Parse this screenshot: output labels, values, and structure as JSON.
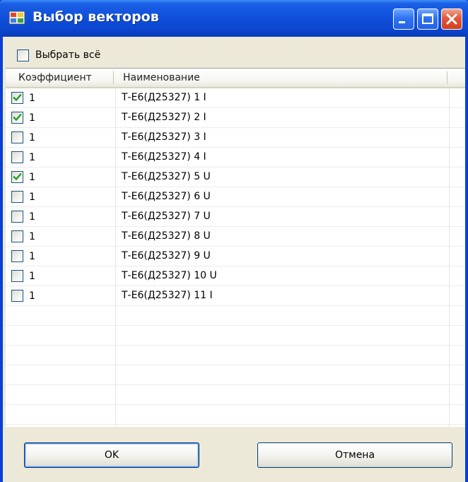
{
  "window": {
    "title": "Выбор векторов",
    "icon": "app-window-icon",
    "controls": [
      "minimize-icon",
      "maximize-icon",
      "close-icon"
    ]
  },
  "select_all": {
    "label": "Выбрать всё",
    "checked": false
  },
  "grid": {
    "columns": [
      "Коэффициент",
      "Наименование"
    ],
    "rows": [
      {
        "coef": "1",
        "name": "Т-Е6(Д25327) 1 I",
        "checked": true
      },
      {
        "coef": "1",
        "name": "Т-Е6(Д25327) 2 I",
        "checked": true
      },
      {
        "coef": "1",
        "name": "Т-Е6(Д25327) 3 I",
        "checked": false
      },
      {
        "coef": "1",
        "name": "Т-Е6(Д25327) 4 I",
        "checked": false
      },
      {
        "coef": "1",
        "name": "Т-Е6(Д25327) 5 U",
        "checked": true
      },
      {
        "coef": "1",
        "name": "Т-Е6(Д25327) 6 U",
        "checked": false
      },
      {
        "coef": "1",
        "name": "Т-Е6(Д25327) 7 U",
        "checked": false
      },
      {
        "coef": "1",
        "name": "Т-Е6(Д25327) 8 U",
        "checked": false
      },
      {
        "coef": "1",
        "name": "Т-Е6(Д25327) 9 U",
        "checked": false
      },
      {
        "coef": "1",
        "name": "Т-Е6(Д25327) 10 U",
        "checked": false
      },
      {
        "coef": "1",
        "name": "Т-Е6(Д25327) 11 I",
        "checked": false
      }
    ]
  },
  "buttons": {
    "ok_label": "OK",
    "cancel_label": "Отмена"
  },
  "colors": {
    "titlebar": "#0f4fd9",
    "check": "#21a121",
    "dialog_bg": "#ece9d8"
  }
}
